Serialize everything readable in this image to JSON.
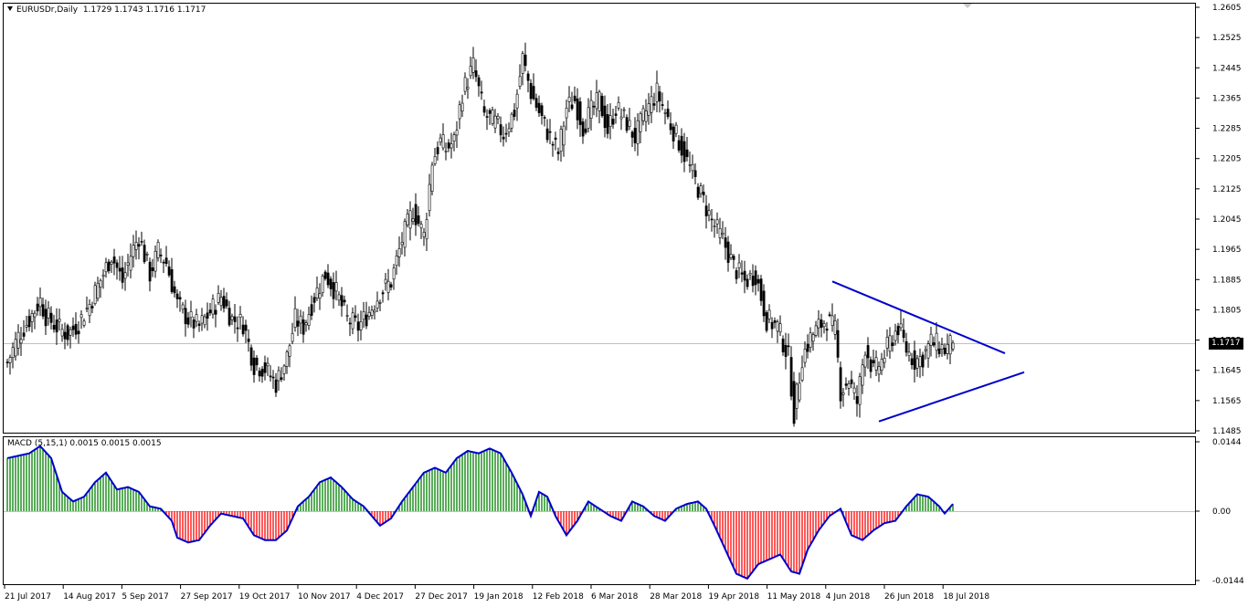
{
  "header": {
    "symbol_line": "EURUSDr,Daily  1.1729 1.1743 1.1716 1.1717"
  },
  "macd_header": "MACD (5,15,1) 0.0015 0.0015 0.0015",
  "current_price_label": "1.1717",
  "colors": {
    "line": "#0000cc",
    "up_hist": "#008000",
    "down_hist": "#ff0000",
    "candle": "#000000",
    "trend_line": "#0000cc"
  },
  "price_axis": [
    "1.2605",
    "1.2525",
    "1.2445",
    "1.2365",
    "1.2285",
    "1.2205",
    "1.2125",
    "1.2045",
    "1.1965",
    "1.1885",
    "1.1805",
    "1.1725",
    "1.1645",
    "1.1565",
    "1.1485"
  ],
  "macd_axis": [
    "0.0144",
    "0.00",
    "-0.0144"
  ],
  "time_axis": [
    "21 Jul 2017",
    "14 Aug 2017",
    "5 Sep 2017",
    "27 Sep 2017",
    "19 Oct 2017",
    "10 Nov 2017",
    "4 Dec 2017",
    "27 Dec 2017",
    "19 Jan 2018",
    "12 Feb 2018",
    "6 Mar 2018",
    "28 Mar 2018",
    "19 Apr 2018",
    "11 May 2018",
    "4 Jun 2018",
    "26 Jun 2018",
    "18 Jul 2018"
  ],
  "chart_data": [
    {
      "type": "candlestick",
      "title": "EURUSDr,Daily",
      "ylim": [
        1.1485,
        1.2605
      ],
      "last_close": 1.1717,
      "x_dates": [
        "21 Jul 2017",
        "14 Aug 2017",
        "5 Sep 2017",
        "27 Sep 2017",
        "19 Oct 2017",
        "10 Nov 2017",
        "4 Dec 2017",
        "27 Dec 2017",
        "19 Jan 2018",
        "12 Feb 2018",
        "6 Mar 2018",
        "28 Mar 2018",
        "19 Apr 2018",
        "11 May 2018",
        "4 Jun 2018",
        "26 Jun 2018",
        "18 Jul 2018"
      ],
      "close_path": [
        [
          0,
          1.1665
        ],
        [
          4,
          1.1735
        ],
        [
          8,
          1.178
        ],
        [
          12,
          1.183
        ],
        [
          14,
          1.179
        ],
        [
          18,
          1.176
        ],
        [
          22,
          1.174
        ],
        [
          26,
          1.177
        ],
        [
          30,
          1.182
        ],
        [
          35,
          1.19
        ],
        [
          38,
          1.195
        ],
        [
          42,
          1.188
        ],
        [
          45,
          1.195
        ],
        [
          48,
          1.2
        ],
        [
          52,
          1.19
        ],
        [
          55,
          1.196
        ],
        [
          58,
          1.193
        ],
        [
          62,
          1.182
        ],
        [
          66,
          1.178
        ],
        [
          70,
          1.176
        ],
        [
          74,
          1.18
        ],
        [
          78,
          1.184
        ],
        [
          82,
          1.178
        ],
        [
          86,
          1.177
        ],
        [
          90,
          1.166
        ],
        [
          94,
          1.165
        ],
        [
          98,
          1.161
        ],
        [
          102,
          1.168
        ],
        [
          105,
          1.178
        ],
        [
          108,
          1.176
        ],
        [
          112,
          1.184
        ],
        [
          116,
          1.19
        ],
        [
          120,
          1.185
        ],
        [
          124,
          1.178
        ],
        [
          128,
          1.176
        ],
        [
          132,
          1.18
        ],
        [
          136,
          1.185
        ],
        [
          140,
          1.188
        ],
        [
          144,
          1.199
        ],
        [
          148,
          1.207
        ],
        [
          152,
          1.2
        ],
        [
          155,
          1.22
        ],
        [
          158,
          1.225
        ],
        [
          160,
          1.223
        ],
        [
          163,
          1.225
        ],
        [
          166,
          1.238
        ],
        [
          170,
          1.245
        ],
        [
          174,
          1.232
        ],
        [
          178,
          1.23
        ],
        [
          181,
          1.227
        ],
        [
          185,
          1.233
        ],
        [
          188,
          1.247
        ],
        [
          191,
          1.238
        ],
        [
          195,
          1.231
        ],
        [
          198,
          1.226
        ],
        [
          201,
          1.222
        ],
        [
          204,
          1.234
        ],
        [
          207,
          1.236
        ],
        [
          210,
          1.229
        ],
        [
          213,
          1.233
        ],
        [
          216,
          1.236
        ],
        [
          219,
          1.228
        ],
        [
          222,
          1.234
        ],
        [
          226,
          1.23
        ],
        [
          229,
          1.226
        ],
        [
          233,
          1.233
        ],
        [
          237,
          1.238
        ],
        [
          241,
          1.231
        ],
        [
          245,
          1.225
        ],
        [
          249,
          1.218
        ],
        [
          253,
          1.211
        ],
        [
          257,
          1.204
        ],
        [
          261,
          1.199
        ],
        [
          265,
          1.192
        ],
        [
          269,
          1.188
        ],
        [
          273,
          1.19
        ],
        [
          277,
          1.178
        ],
        [
          281,
          1.176
        ],
        [
          285,
          1.168
        ],
        [
          287,
          1.153
        ],
        [
          290,
          1.168
        ],
        [
          293,
          1.173
        ],
        [
          296,
          1.176
        ],
        [
          299,
          1.178
        ],
        [
          302,
          1.175
        ],
        [
          304,
          1.159
        ],
        [
          307,
          1.162
        ],
        [
          310,
          1.156
        ],
        [
          313,
          1.171
        ],
        [
          316,
          1.164
        ],
        [
          319,
          1.167
        ],
        [
          322,
          1.172
        ],
        [
          325,
          1.176
        ],
        [
          328,
          1.17
        ],
        [
          331,
          1.167
        ],
        [
          334,
          1.168
        ],
        [
          337,
          1.172
        ],
        [
          340,
          1.171
        ],
        [
          342,
          1.17
        ],
        [
          345,
          1.1717
        ]
      ],
      "trend_lines": [
        {
          "from": [
            301,
            1.188
          ],
          "to": [
            364,
            1.169
          ]
        },
        {
          "from": [
            318,
            1.151
          ],
          "to": [
            371,
            1.164
          ]
        }
      ]
    },
    {
      "type": "bar",
      "title": "MACD (5,15,1)",
      "values_label": "0.0015 0.0015 0.0015",
      "ylim": [
        -0.0144,
        0.0144
      ],
      "path": [
        [
          0,
          0.011
        ],
        [
          8,
          0.012
        ],
        [
          12,
          0.0135
        ],
        [
          16,
          0.011
        ],
        [
          20,
          0.004
        ],
        [
          24,
          0.002
        ],
        [
          28,
          0.003
        ],
        [
          32,
          0.006
        ],
        [
          36,
          0.008
        ],
        [
          40,
          0.0045
        ],
        [
          44,
          0.005
        ],
        [
          48,
          0.004
        ],
        [
          52,
          0.001
        ],
        [
          56,
          0.0005
        ],
        [
          60,
          -0.002
        ],
        [
          62,
          -0.0055
        ],
        [
          66,
          -0.0065
        ],
        [
          70,
          -0.006
        ],
        [
          74,
          -0.003
        ],
        [
          78,
          -0.0005
        ],
        [
          82,
          -0.001
        ],
        [
          86,
          -0.0015
        ],
        [
          90,
          -0.005
        ],
        [
          94,
          -0.006
        ],
        [
          98,
          -0.006
        ],
        [
          102,
          -0.004
        ],
        [
          106,
          0.001
        ],
        [
          110,
          0.003
        ],
        [
          114,
          0.006
        ],
        [
          118,
          0.007
        ],
        [
          122,
          0.005
        ],
        [
          126,
          0.0025
        ],
        [
          130,
          0.001
        ],
        [
          133,
          -0.001
        ],
        [
          136,
          -0.003
        ],
        [
          140,
          -0.0015
        ],
        [
          144,
          0.002
        ],
        [
          148,
          0.005
        ],
        [
          152,
          0.008
        ],
        [
          156,
          0.009
        ],
        [
          160,
          0.008
        ],
        [
          164,
          0.011
        ],
        [
          168,
          0.0125
        ],
        [
          172,
          0.012
        ],
        [
          176,
          0.013
        ],
        [
          180,
          0.012
        ],
        [
          184,
          0.008
        ],
        [
          188,
          0.0035
        ],
        [
          191,
          -0.001
        ],
        [
          194,
          0.004
        ],
        [
          197,
          0.003
        ],
        [
          200,
          -0.001
        ],
        [
          204,
          -0.005
        ],
        [
          208,
          -0.002
        ],
        [
          212,
          0.002
        ],
        [
          216,
          0.0005
        ],
        [
          220,
          -0.001
        ],
        [
          224,
          -0.002
        ],
        [
          228,
          0.002
        ],
        [
          232,
          0.001
        ],
        [
          236,
          -0.001
        ],
        [
          240,
          -0.002
        ],
        [
          244,
          0.0005
        ],
        [
          248,
          0.0015
        ],
        [
          252,
          0.002
        ],
        [
          255,
          0.0005
        ],
        [
          258,
          -0.003
        ],
        [
          262,
          -0.008
        ],
        [
          266,
          -0.013
        ],
        [
          270,
          -0.014
        ],
        [
          274,
          -0.011
        ],
        [
          278,
          -0.01
        ],
        [
          282,
          -0.009
        ],
        [
          286,
          -0.0125
        ],
        [
          289,
          -0.013
        ],
        [
          292,
          -0.008
        ],
        [
          296,
          -0.004
        ],
        [
          300,
          -0.001
        ],
        [
          304,
          0.0005
        ],
        [
          308,
          -0.005
        ],
        [
          312,
          -0.006
        ],
        [
          316,
          -0.004
        ],
        [
          320,
          -0.0025
        ],
        [
          324,
          -0.002
        ],
        [
          328,
          0.001
        ],
        [
          332,
          0.0035
        ],
        [
          336,
          0.003
        ],
        [
          340,
          0.001
        ],
        [
          342,
          -0.0005
        ],
        [
          345,
          0.0015
        ]
      ]
    }
  ]
}
